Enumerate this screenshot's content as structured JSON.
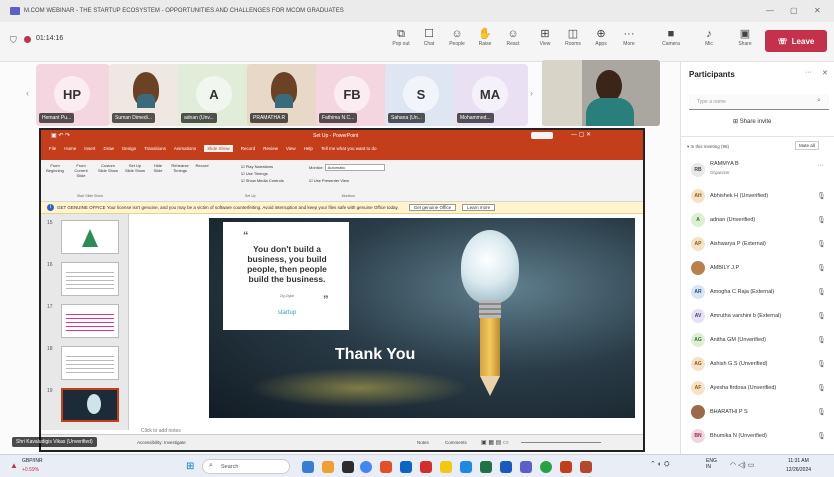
{
  "window": {
    "title": "M.COM WEBINAR - THE STARTUP ECOSYSTEM - OPPORTUNITIES AND CHALLENGES FOR MCOM GRADUATES"
  },
  "toolbar": {
    "timer": "01:14:16",
    "buttons": [
      "Pop out",
      "Chat",
      "People",
      "Raise",
      "React",
      "View",
      "Rooms",
      "Apps",
      "More",
      "Camera",
      "Mic",
      "Share"
    ],
    "leave_label": "Leave"
  },
  "tiles": [
    {
      "initials": "HP",
      "name": "Hemant Pu...",
      "color": "#f3d6df"
    },
    {
      "initials": "",
      "name": "Suman Dimedi...",
      "color": "#efe7e2"
    },
    {
      "initials": "A",
      "name": "adnan (Unv...",
      "color": "#e1ecd9"
    },
    {
      "initials": "",
      "name": "PRAMATHA R",
      "color": "#e7d8c8"
    },
    {
      "initials": "FB",
      "name": "Fathima N.C...",
      "color": "#f3d6df"
    },
    {
      "initials": "S",
      "name": "Sahana (Un...",
      "color": "#dfe6f3"
    },
    {
      "initials": "MA",
      "name": "Mohammed...",
      "color": "#e9e1f3"
    }
  ],
  "ppt": {
    "title": "Set Up - PowerPoint",
    "ribbon_tabs": [
      "File",
      "Home",
      "Insert",
      "Draw",
      "Design",
      "Transitions",
      "Animations",
      "Slide Show",
      "Record",
      "Review",
      "View",
      "Help",
      "Tell me what you want to do"
    ],
    "ribbon_groups": [
      "From Beginning",
      "From Current Slide",
      "Custom Slide Show",
      "Set Up Slide Show",
      "Hide Slide",
      "Rehearse Timings",
      "Record"
    ],
    "ribbon_checks": [
      "Play Narrations",
      "Use Timings",
      "Show Media Controls"
    ],
    "monitor_label": "Monitor:",
    "monitor_value": "Automatic",
    "presenter_label": "Use Presenter View",
    "group_captions": [
      "Start Slide Show",
      "Set Up",
      "Monitors"
    ],
    "warning": "GET GENUINE OFFICE  Your license isn't genuine, and you may be a victim of software counterfeiting. Avoid interruption and keep your files safe with genuine Office today.",
    "warning_btn1": "Get genuine Office",
    "warning_btn2": "Learn more",
    "thumb_numbers": [
      "15",
      "16",
      "17",
      "18",
      "19"
    ],
    "quote": "You don't build a business, you build people, then people build the business.",
    "quote_author": "Zig Ziglar",
    "quote_brand": "startup",
    "thank_you": "Thank You",
    "notes_placeholder": "Click to add notes",
    "status_left": "Accessibility: Investigate",
    "status_right": "Notes",
    "status_comments": "Comments"
  },
  "presenter_caption": "Shri Kavaludigis Vikas (Unverified)",
  "panel": {
    "title": "Participants",
    "search_placeholder": "Type a name",
    "share_invite": "Share invite",
    "section_label": "In this meeting (98)",
    "mute_all": "Mute all",
    "people": [
      {
        "initials": "RB",
        "name": "RAMMYA B",
        "sub": "Organizer",
        "color": "#e8e8e8"
      },
      {
        "initials": "AH",
        "name": "Abhishek H (Unverified)",
        "color": "#f6e3c7"
      },
      {
        "initials": "A",
        "name": "adnan (Unverified)",
        "color": "#dcefd3"
      },
      {
        "initials": "AP",
        "name": "Aishwarya P (External)",
        "color": "#f6e3c7"
      },
      {
        "initials": "",
        "name": "AMBILY J.P",
        "color": "#b7814e"
      },
      {
        "initials": "AR",
        "name": "Amogha C Raja (External)",
        "color": "#d7e5f5"
      },
      {
        "initials": "AV",
        "name": "Amrutha varshini b (External)",
        "color": "#e6e1f5"
      },
      {
        "initials": "AG",
        "name": "Anitha GM (Unverified)",
        "color": "#dcefd3"
      },
      {
        "initials": "AG",
        "name": "Ashish G.S (Unverified)",
        "color": "#f6e3c7"
      },
      {
        "initials": "AF",
        "name": "Ayesha firdosa (Unverified)",
        "color": "#f6e3c7"
      },
      {
        "initials": "",
        "name": "BHARATHI P S",
        "color": "#9a6a4a"
      },
      {
        "initials": "BN",
        "name": "Bhumika N (Unverified)",
        "color": "#f3d6df"
      }
    ]
  },
  "taskbar": {
    "weather_label": "GBP/INR",
    "weather_value": "+0.59%",
    "search_label": "Search",
    "lang": "ENG\nIN",
    "time": "11:31 AM",
    "date": "12/26/2024"
  }
}
